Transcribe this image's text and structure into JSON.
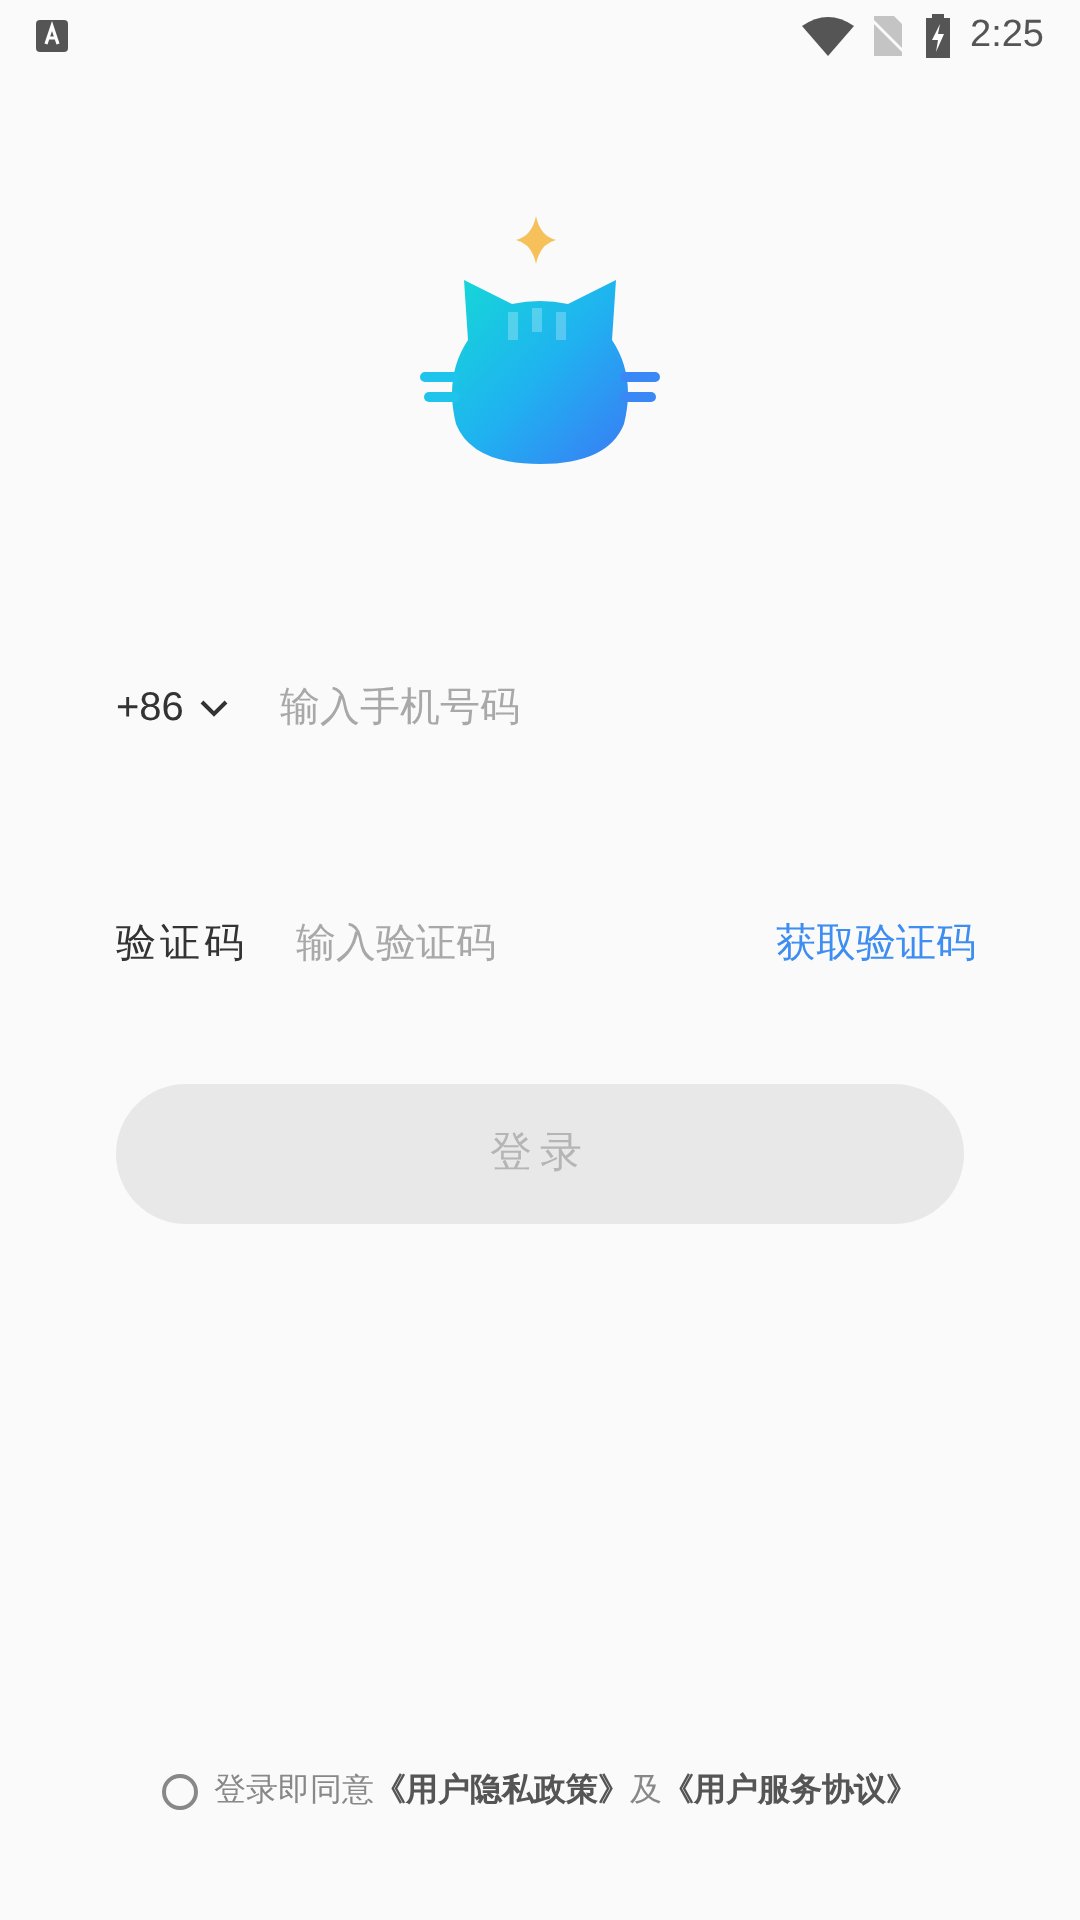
{
  "status_bar": {
    "time": "2:25"
  },
  "phone": {
    "country_code": "+86",
    "placeholder": "输入手机号码"
  },
  "code": {
    "label": "验证码",
    "placeholder": "输入验证码",
    "get_code": "获取验证码"
  },
  "login_button": {
    "label": "登录",
    "disabled": true
  },
  "agreement": {
    "checked": false,
    "prefix": "登录即同意",
    "privacy_link": "《用户隐私政策》",
    "joiner": "及",
    "service_link": "《用户服务协议》"
  }
}
